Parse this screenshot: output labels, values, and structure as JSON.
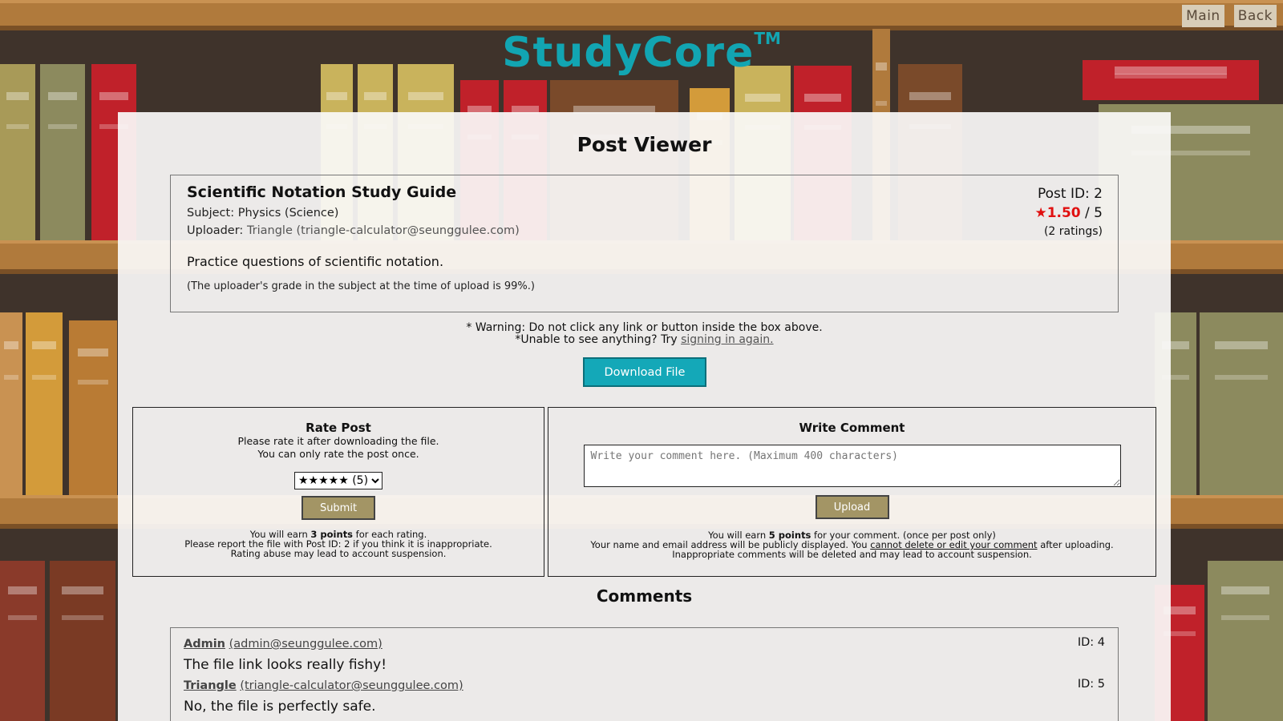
{
  "nav": {
    "main_label": "Main",
    "back_label": "Back"
  },
  "logo": {
    "text": "StudyCore",
    "tm": "TM"
  },
  "page": {
    "title": "Post Viewer"
  },
  "post": {
    "title": "Scientific Notation Study Guide",
    "subject_label": "Subject:",
    "subject_value": "Physics (Science)",
    "uploader_label": "Uploader:",
    "uploader_value": "Triangle (triangle-calculator@seunggulee.com)",
    "id_text": "Post ID: 2",
    "rating_star": "★",
    "rating_value": "1.50",
    "rating_max": " / 5",
    "rating_count": "(2 ratings)",
    "description": "Practice questions of scientific notation.",
    "note": "(The uploader's grade in the subject at the time of upload is 99%.)"
  },
  "warning": {
    "line1": "* Warning: Do not click any link or button inside the box above.",
    "line2_prefix": "*Unable to see anything? Try ",
    "line2_link": "signing in again."
  },
  "download_label": "Download File",
  "rate": {
    "title": "Rate Post",
    "sub1": "Please rate it after downloading the file.",
    "sub2": "You can only rate the post once.",
    "selected_option": "★★★★★ (5)",
    "submit_label": "Submit",
    "foot1_prefix": "You will earn ",
    "foot1_bold": "3 points",
    "foot1_suffix": " for each rating.",
    "foot2": "Please report the file with Post ID: 2 if you think it is inappropriate.",
    "foot3": "Rating abuse may lead to account suspension."
  },
  "write_comment": {
    "title": "Write Comment",
    "placeholder": "Write your comment here. (Maximum 400 characters)",
    "upload_label": "Upload",
    "foot1_prefix": "You will earn ",
    "foot1_bold": "5 points",
    "foot1_suffix": " for your comment. (once per post only)",
    "foot2_prefix": "Your name and email address will be publicly displayed. You ",
    "foot2_link": "cannot delete or edit your comment",
    "foot2_suffix": " after uploading.",
    "foot3": "Inappropriate comments will be deleted and may lead to account suspension."
  },
  "comments": {
    "title": "Comments",
    "items": [
      {
        "author": "Admin",
        "email": "(admin@seunggulee.com)",
        "id": "ID: 4",
        "text": "The file link looks really fishy!"
      },
      {
        "author": "Triangle",
        "email": "(triangle-calculator@seunggulee.com)",
        "id": "ID: 5",
        "text": "No, the file is perfectly safe."
      }
    ]
  }
}
